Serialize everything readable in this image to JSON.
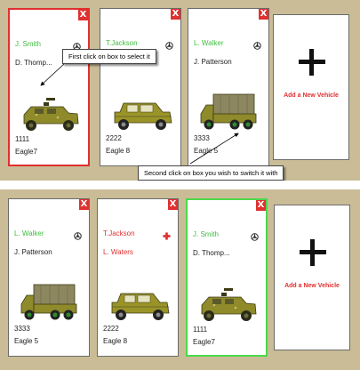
{
  "top_panel": {
    "cards": [
      {
        "driver": "J. Smith",
        "partner": "D. Thomp...",
        "unit_number": "1111",
        "unit_name": "Eagle7",
        "close_label": "X",
        "vehicle_icon": "humvee-icon",
        "status_icon": "steering-wheel-icon"
      },
      {
        "driver": "T.Jackson",
        "partner": "L. Waters",
        "unit_number": "2222",
        "unit_name": "Eagle 8",
        "close_label": "X",
        "vehicle_icon": "suv-icon",
        "status_icon": "steering-wheel-icon"
      },
      {
        "driver": "L. Walker",
        "partner": "J. Patterson",
        "unit_number": "3333",
        "unit_name": "Eagle 5",
        "close_label": "X",
        "vehicle_icon": "covered-truck-icon",
        "status_icon": "steering-wheel-icon"
      }
    ],
    "add_vehicle_label": "Add a New Vehicle"
  },
  "bottom_panel": {
    "cards": [
      {
        "driver": "L. Walker",
        "partner": "J. Patterson",
        "unit_number": "3333",
        "unit_name": "Eagle 5",
        "close_label": "X",
        "vehicle_icon": "covered-truck-icon",
        "status_icon": "steering-wheel-icon"
      },
      {
        "driver": "T.Jackson",
        "partner": "L. Waters",
        "unit_number": "2222",
        "unit_name": "Eagle 8",
        "close_label": "X",
        "vehicle_icon": "suv-icon",
        "status_icon": "red-cross-icon"
      },
      {
        "driver": "J. Smith",
        "partner": "D. Thomp...",
        "unit_number": "1111",
        "unit_name": "Eagle7",
        "close_label": "X",
        "vehicle_icon": "humvee-icon",
        "status_icon": "steering-wheel-icon"
      }
    ],
    "add_vehicle_label": "Add a New Vehicle"
  },
  "tooltips": {
    "first": "First click on box to select it",
    "second": "Second click on box you wish to switch it with"
  },
  "colors": {
    "background": "#c9bc96",
    "selected_red": "#e03030",
    "selected_green": "#4cd84c",
    "driver_green": "#3fbf3f",
    "alert_red": "#e03030",
    "vehicle_olive": "#8f8a2a"
  }
}
